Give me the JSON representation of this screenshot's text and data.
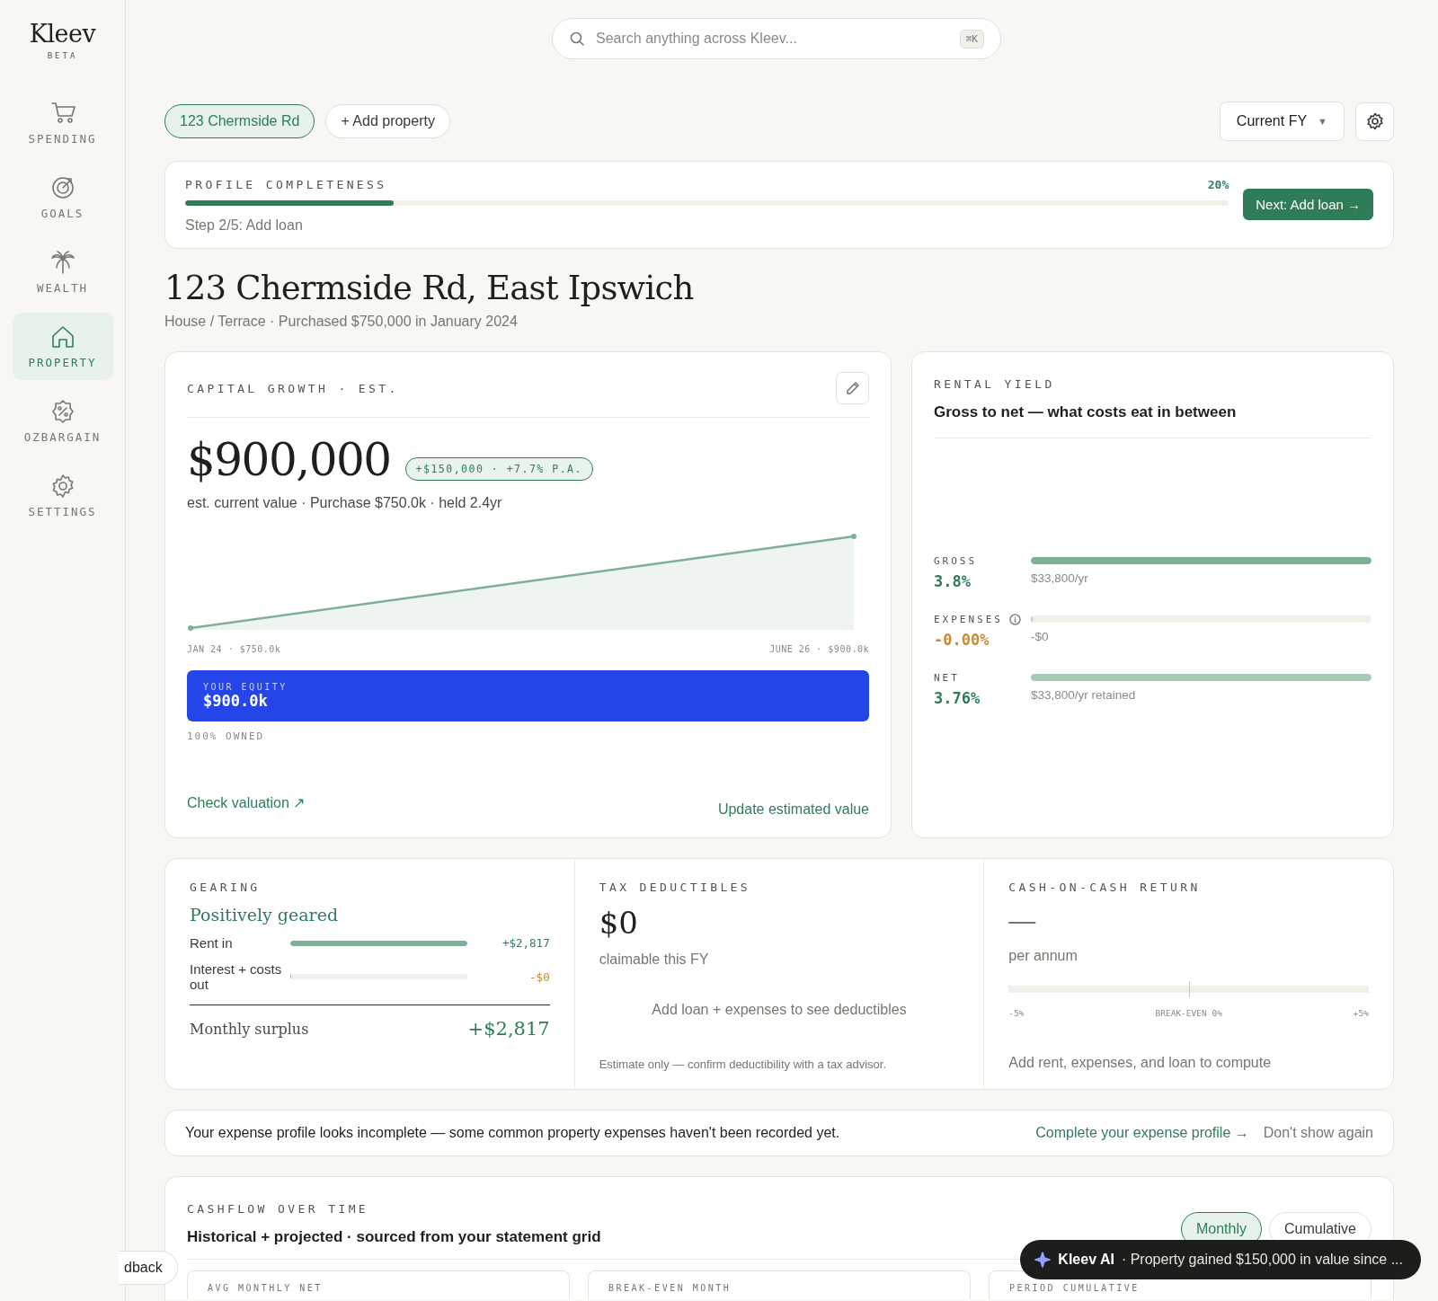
{
  "sidebar": {
    "logo": "Kleev",
    "badge": "BETA",
    "items": [
      {
        "label": "SPENDING",
        "kind": "cart",
        "selected": false
      },
      {
        "label": "GOALS",
        "kind": "target",
        "selected": false
      },
      {
        "label": "WEALTH",
        "kind": "palm",
        "selected": false
      },
      {
        "label": "PROPERTY",
        "kind": "home",
        "selected": true
      },
      {
        "label": "OZBARGAIN",
        "kind": "discount",
        "selected": false
      },
      {
        "label": "SETTINGS",
        "kind": "gear",
        "selected": false
      }
    ]
  },
  "search": {
    "placeholder": "Search anything across Kleev...",
    "shortcut": "⌘K"
  },
  "properties": [
    {
      "label": "123 Chermside Rd",
      "selected": true
    }
  ],
  "add_property": "+ Add property",
  "period_select": {
    "value": "Current FY",
    "caret": "▼"
  },
  "completeness": {
    "title": "PROFILE COMPLETENESS",
    "level": 0.2,
    "percent": "20%",
    "step": "Step 2/5: Add loan",
    "action": "Next: Add loan →"
  },
  "heading": {
    "title": "123 Chermside Rd, East Ipswich",
    "subtitle": "House / Terrace · Purchased $750,000 in January 2024"
  },
  "capital_growth": {
    "title": "CAPITAL GROWTH · EST.",
    "value": "$900,000",
    "change": "+$150,000 · +7.7% P.A.",
    "caption": "est. current value · Purchase $750.0k · held 2.4yr",
    "start_label": "JAN 24 · $750.0k",
    "end_label": "JUNE 26 · $900.0k",
    "equity": {
      "label": "YOUR EQUITY",
      "value": "$900.0k",
      "level": 1
    },
    "ownership": "100% OWNED",
    "check_link": "Check valuation ↗",
    "update_link": "Update estimated value"
  },
  "rental_yield": {
    "title": "RENTAL YIELD",
    "subtitle": "Gross to net — what costs eat in between",
    "rows": [
      {
        "label": "GROSS",
        "value": "3.8%",
        "kind": "gain",
        "info": false,
        "level": 1,
        "color": "#7fb095",
        "note": "$33,800/yr"
      },
      {
        "label": "EXPENSES",
        "value": "-0.00%",
        "kind": "cost",
        "info": true,
        "level": 0.004,
        "color": "#c9c9c0",
        "note": "-$0"
      },
      {
        "label": "NET",
        "value": "3.76%",
        "kind": "gain",
        "info": false,
        "level": 1,
        "color": "#a8cab6",
        "note": "$33,800/yr retained"
      }
    ]
  },
  "gearing": {
    "title": "GEARING",
    "status": "Positively geared",
    "rows": [
      {
        "label": "Rent in",
        "level": 1,
        "amount": "+$2,817",
        "kind": "gain"
      },
      {
        "label": "Interest + costs out",
        "level": 0.004,
        "amount": "-$0",
        "kind": "cost"
      }
    ],
    "total_label": "Monthly surplus",
    "total": "+$2,817"
  },
  "tax_deductibles": {
    "title": "TAX DEDUCTIBLES",
    "value": "$0",
    "caption": "claimable this FY",
    "hint": "Add loan + expenses to see deductibles",
    "disclaimer": "Estimate only — confirm deductibility with a tax advisor."
  },
  "cash_on_cash": {
    "title": "CASH-ON-CASH RETURN",
    "value": "—",
    "caption": "per annum",
    "scale": [
      "-5%",
      "BREAK-EVEN 0%",
      "+5%"
    ],
    "hint": "Add rent, expenses, and loan to compute"
  },
  "banner": {
    "message": "Your expense profile looks incomplete — some common property expenses haven't been recorded yet.",
    "action": "Complete your expense profile →",
    "dismiss": "Don't show again"
  },
  "cashflow": {
    "title": "CASHFLOW OVER TIME",
    "subtitle": "Historical + projected · sourced from your statement grid",
    "views": [
      {
        "label": "Monthly",
        "selected": true
      },
      {
        "label": "Cumulative",
        "selected": false
      }
    ],
    "stats": [
      "AVG MONTHLY NET",
      "BREAK-EVEN MONTH",
      "PERIOD CUMULATIVE"
    ]
  },
  "feedback": "dback",
  "ai_toast": {
    "name": "Kleev AI",
    "message": "· Property gained $150,000 in value since ..."
  }
}
